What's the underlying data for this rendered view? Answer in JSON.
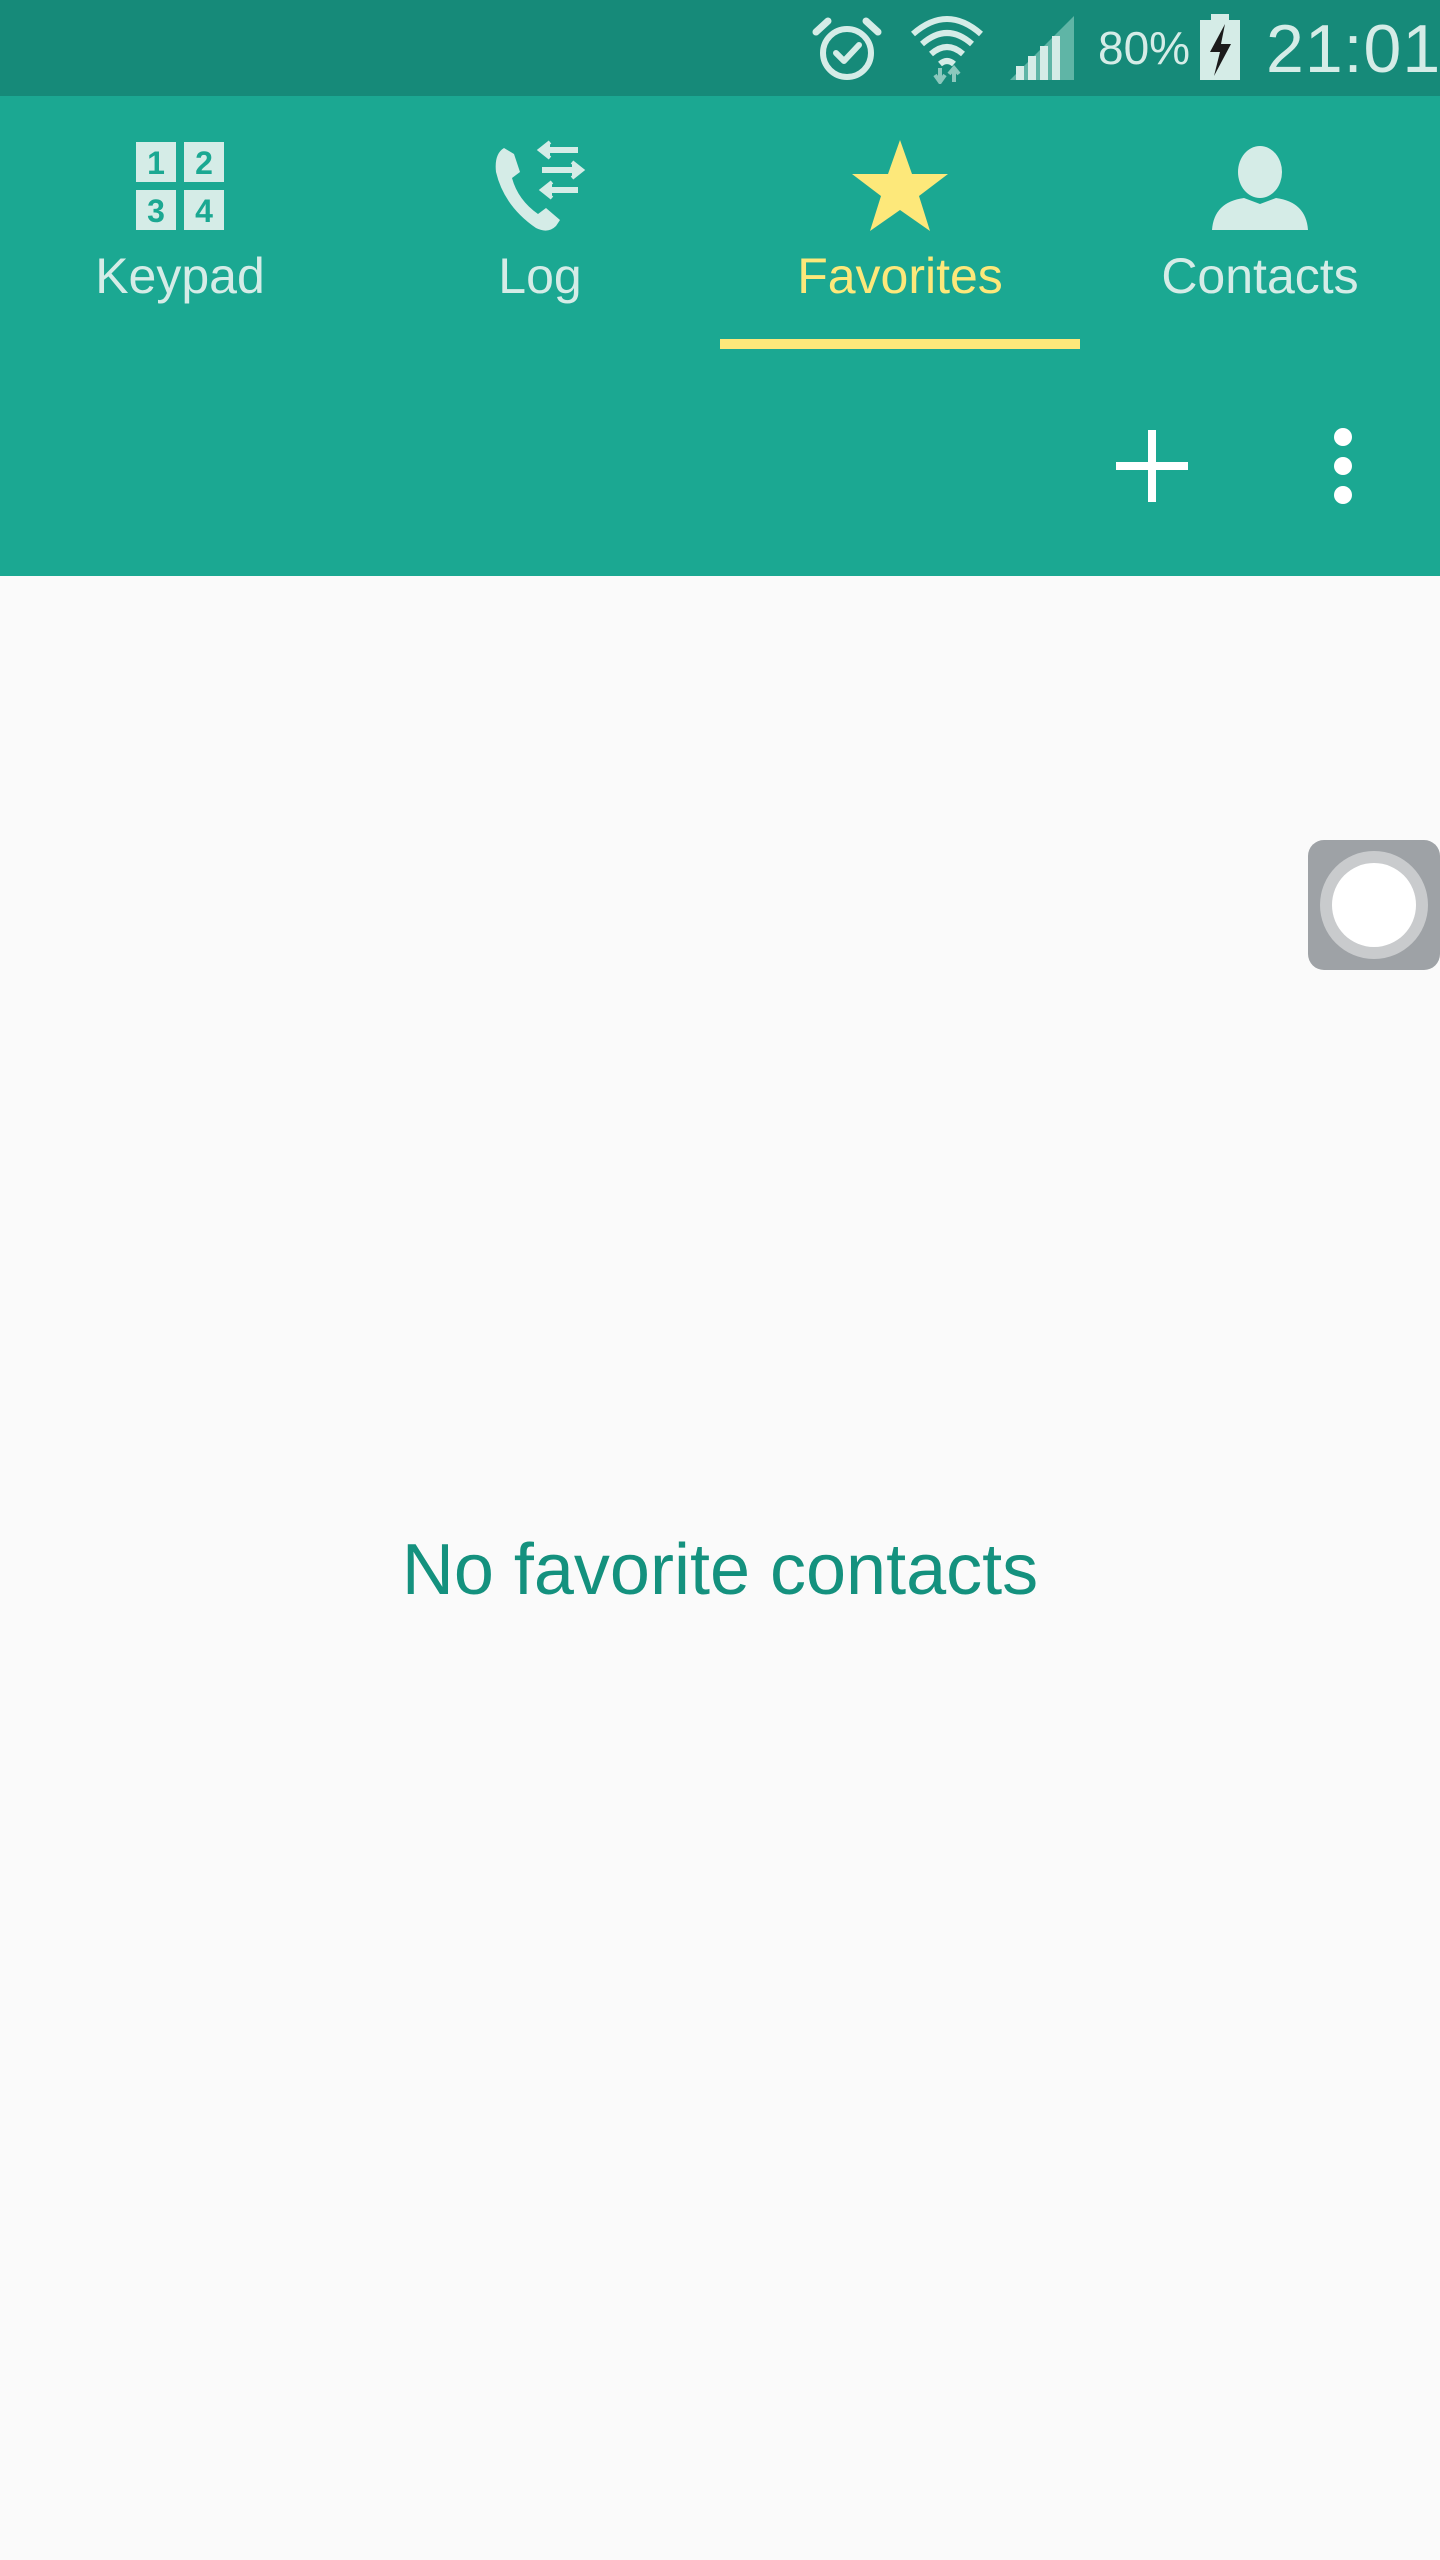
{
  "status_bar": {
    "battery_percent": "80%",
    "time": "21:01",
    "icons": [
      "alarm-icon",
      "wifi-icon",
      "signal-icon",
      "battery-charging-icon"
    ]
  },
  "tabs": [
    {
      "label": "Keypad",
      "icon": "keypad-icon",
      "active": false
    },
    {
      "label": "Log",
      "icon": "call-log-icon",
      "active": false
    },
    {
      "label": "Favorites",
      "icon": "star-icon",
      "active": true
    },
    {
      "label": "Contacts",
      "icon": "contact-person-icon",
      "active": false
    }
  ],
  "actions": {
    "add_icon": "plus-icon",
    "more_icon": "more-vertical-icon"
  },
  "main": {
    "empty_message": "No favorite contacts"
  },
  "colors": {
    "status_bar": "#168a79",
    "header": "#1ba892",
    "active_tab": "#fde87a",
    "inactive_tab": "#d5ece7",
    "empty_text": "#14917e",
    "background": "#fafafa"
  }
}
